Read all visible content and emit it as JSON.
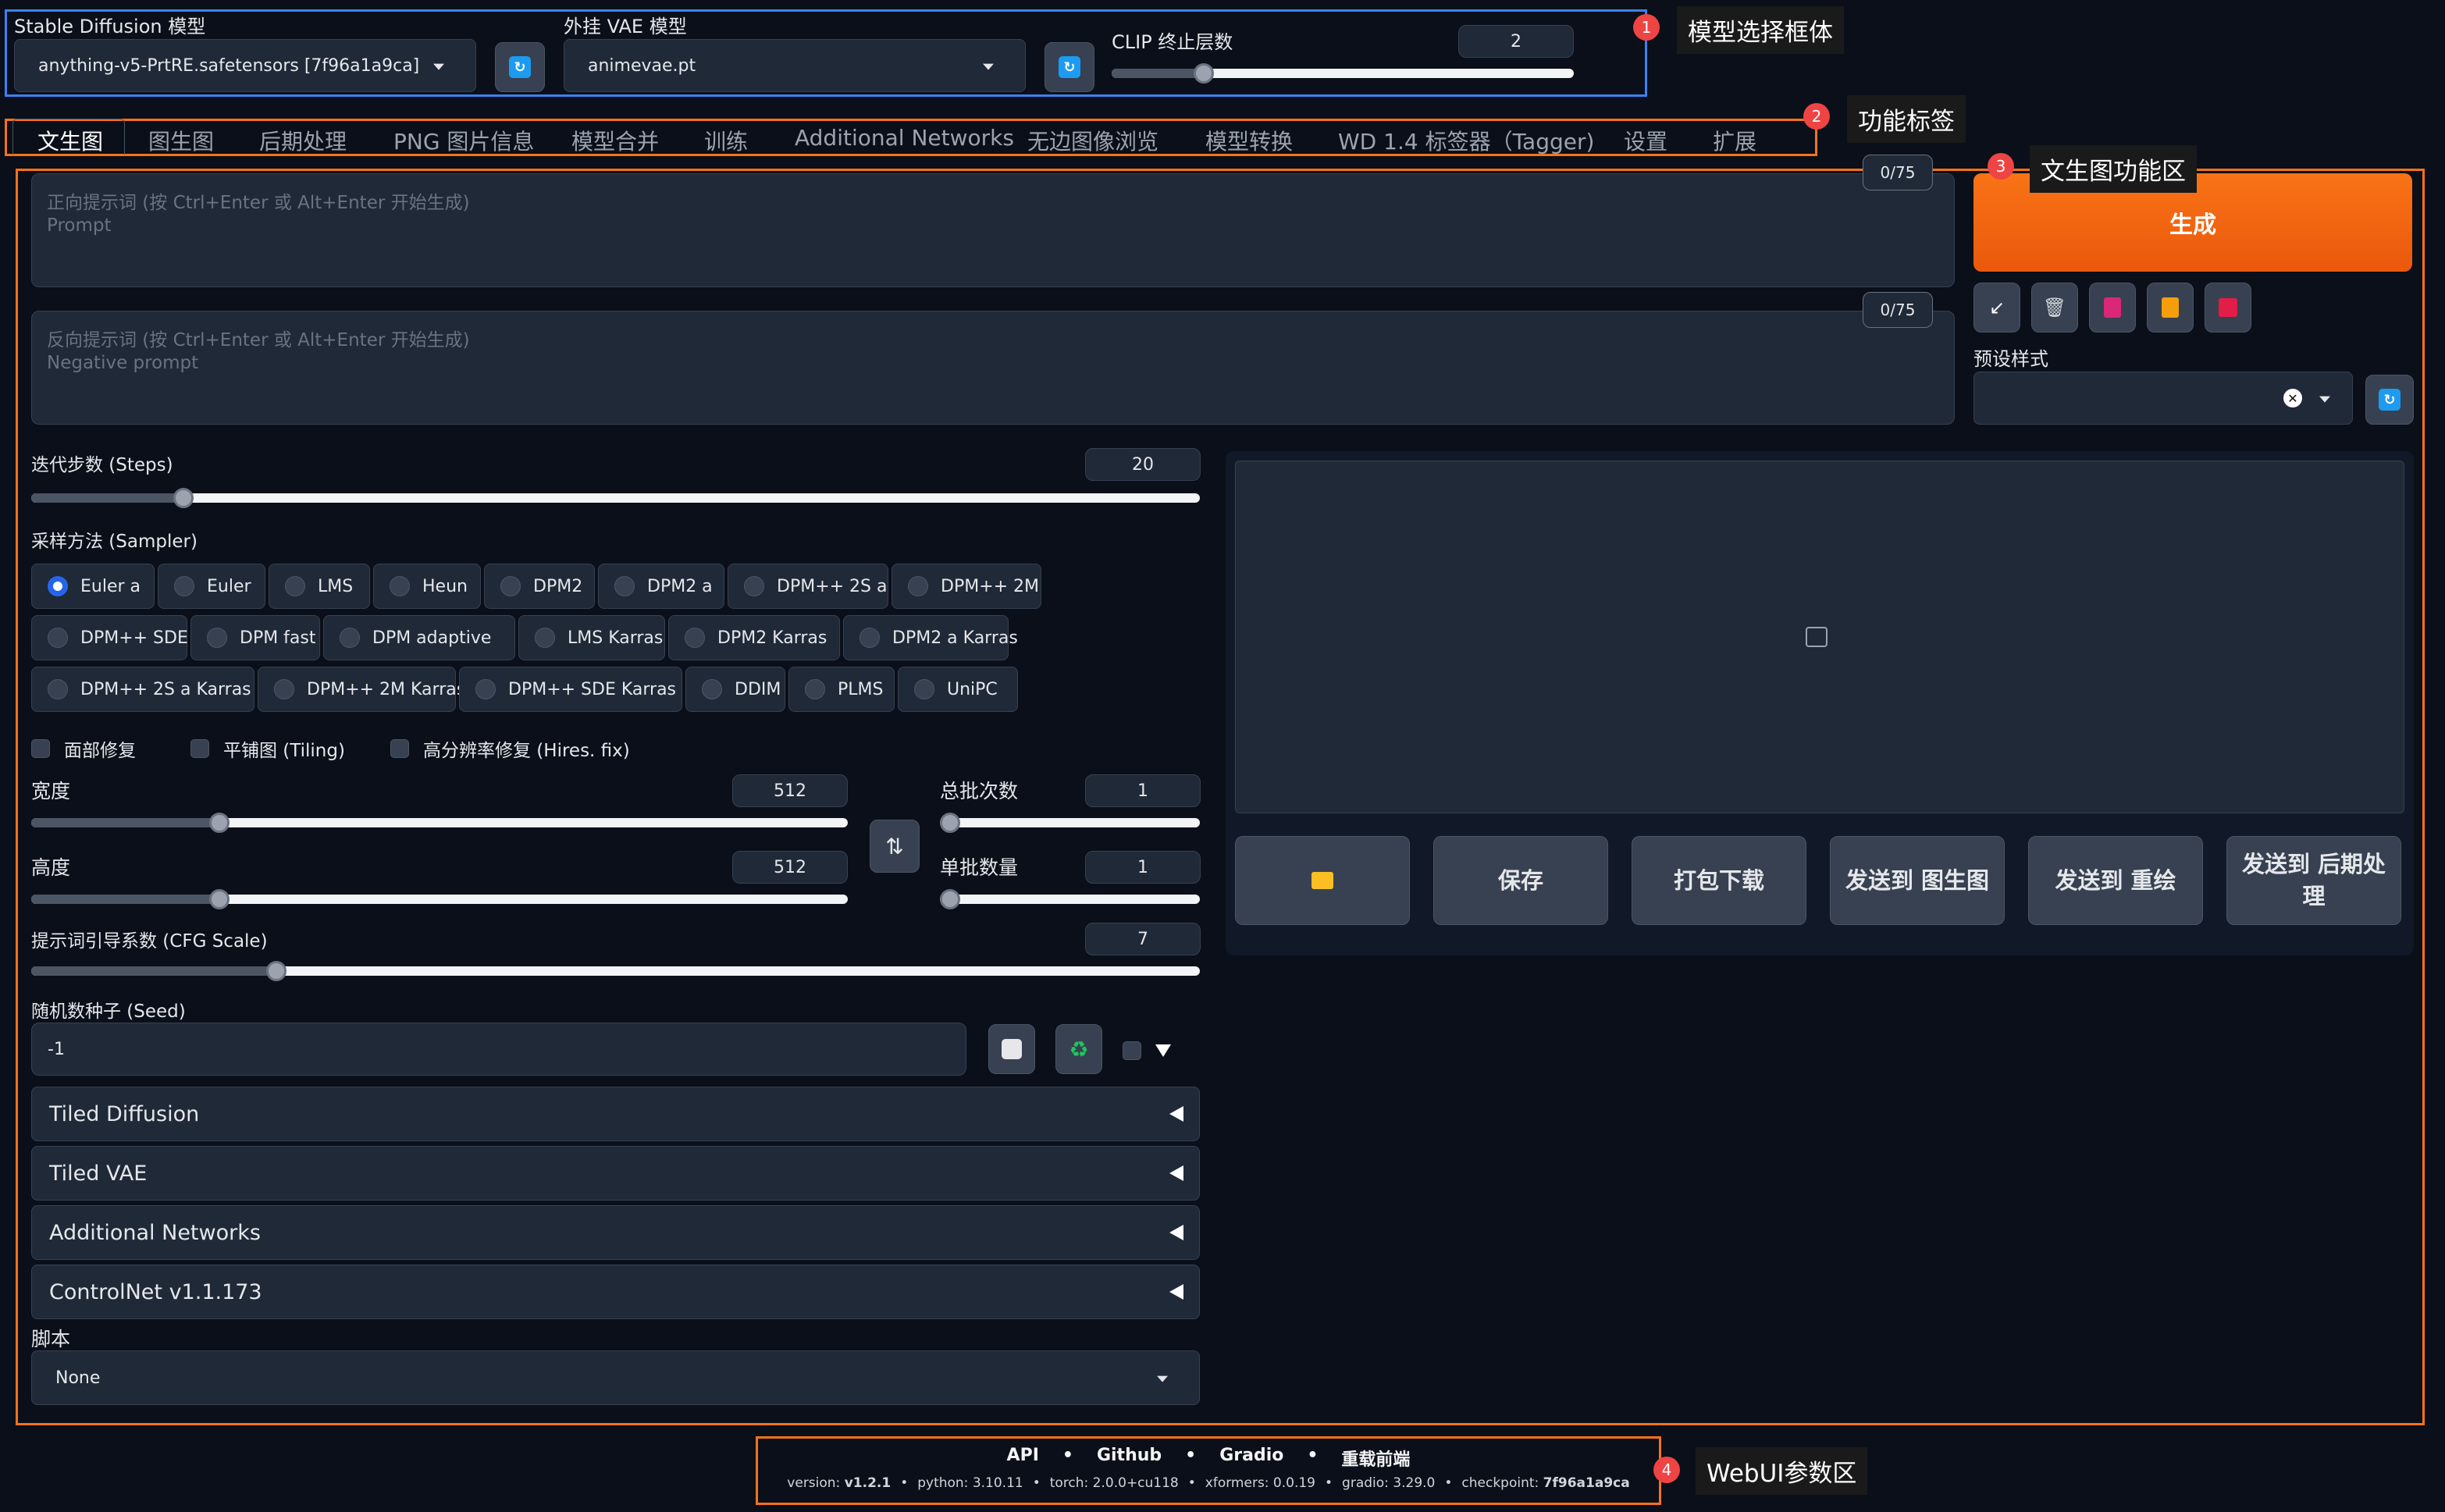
{
  "model_bar": {
    "sd_label": "Stable Diffusion 模型",
    "sd_value": "anything-v5-PrtRE.safetensors [7f96a1a9ca]",
    "vae_label": "外挂 VAE 模型",
    "vae_value": "animevae.pt",
    "clip_label": "CLIP 终止层数",
    "clip_value": "2",
    "clip_level": 0.2
  },
  "tabs": [
    "文生图",
    "图生图",
    "后期处理",
    "PNG 图片信息",
    "模型合并",
    "训练",
    "Additional Networks",
    "无边图像浏览",
    "模型转换",
    "WD 1.4 标签器（Tagger)",
    "设置",
    "扩展"
  ],
  "prompt": {
    "token_count": "0/75",
    "placeholder": "正向提示词 (按 Ctrl+Enter 或 Alt+Enter 开始生成)",
    "placeholder_sub": "Prompt"
  },
  "negative": {
    "token_count": "0/75",
    "placeholder": "反向提示词 (按 Ctrl+Enter 或 Alt+Enter 开始生成)",
    "placeholder_sub": "Negative prompt"
  },
  "generate_label": "生成",
  "tool_icons": [
    "arrow-icon",
    "trash-icon",
    "card-icon",
    "clipboard-icon",
    "save-icon"
  ],
  "styles_label": "预设样式",
  "steps": {
    "label": "迭代步数 (Steps)",
    "value": "20",
    "level": 0.13
  },
  "sampler": {
    "label": "采样方法 (Sampler)",
    "options": [
      "Euler a",
      "Euler",
      "LMS",
      "Heun",
      "DPM2",
      "DPM2 a",
      "DPM++ 2S a",
      "DPM++ 2M",
      "DPM++ SDE",
      "DPM fast",
      "DPM adaptive",
      "LMS Karras",
      "DPM2 Karras",
      "DPM2 a Karras",
      "DPM++ 2S a Karras",
      "DPM++ 2M Karras",
      "DPM++ SDE Karras",
      "DDIM",
      "PLMS",
      "UniPC"
    ],
    "selected": "Euler a"
  },
  "checks": [
    "面部修复",
    "平铺图 (Tiling)",
    "高分辨率修复 (Hires. fix)"
  ],
  "width": {
    "label": "宽度",
    "value": "512",
    "level": 0.23
  },
  "height": {
    "label": "高度",
    "value": "512",
    "level": 0.23
  },
  "batch_count": {
    "label": "总批次数",
    "value": "1",
    "level": 0
  },
  "batch_size": {
    "label": "单批数量",
    "value": "1",
    "level": 0
  },
  "cfg": {
    "label": "提示词引导系数 (CFG Scale)",
    "value": "7",
    "level": 0.21
  },
  "seed": {
    "label": "随机数种子 (Seed)",
    "value": "-1"
  },
  "accordions": [
    "Tiled Diffusion",
    "Tiled VAE",
    "Additional Networks",
    "ControlNet v1.1.173"
  ],
  "script": {
    "label": "脚本",
    "value": "None"
  },
  "gallery_buttons": [
    "保存",
    "打包下载",
    "发送到 图生图",
    "发送到 重绘",
    "发送到 后期处理"
  ],
  "footer": {
    "links": [
      "API",
      "Github",
      "Gradio",
      "重载前端"
    ],
    "info": [
      {
        "k": "version: ",
        "v": "v1.2.1"
      },
      {
        "k": "python: 3.10.11",
        "v": ""
      },
      {
        "k": "torch: 2.0.0+cu118",
        "v": ""
      },
      {
        "k": "xformers: 0.0.19",
        "v": ""
      },
      {
        "k": "gradio: 3.29.0",
        "v": ""
      },
      {
        "k": "checkpoint: ",
        "v": "7f96a1a9ca"
      }
    ]
  },
  "annotations": [
    {
      "num": "1",
      "label": "模型选择框体"
    },
    {
      "num": "2",
      "label": "功能标签"
    },
    {
      "num": "3",
      "label": "文生图功能区"
    },
    {
      "num": "4",
      "label": "WebUI参数区"
    }
  ],
  "colors": {
    "accent": "#f97316",
    "annotation_blue": "#3b82f6",
    "annotation_orange": "#f97316",
    "badge": "#ef4444"
  }
}
